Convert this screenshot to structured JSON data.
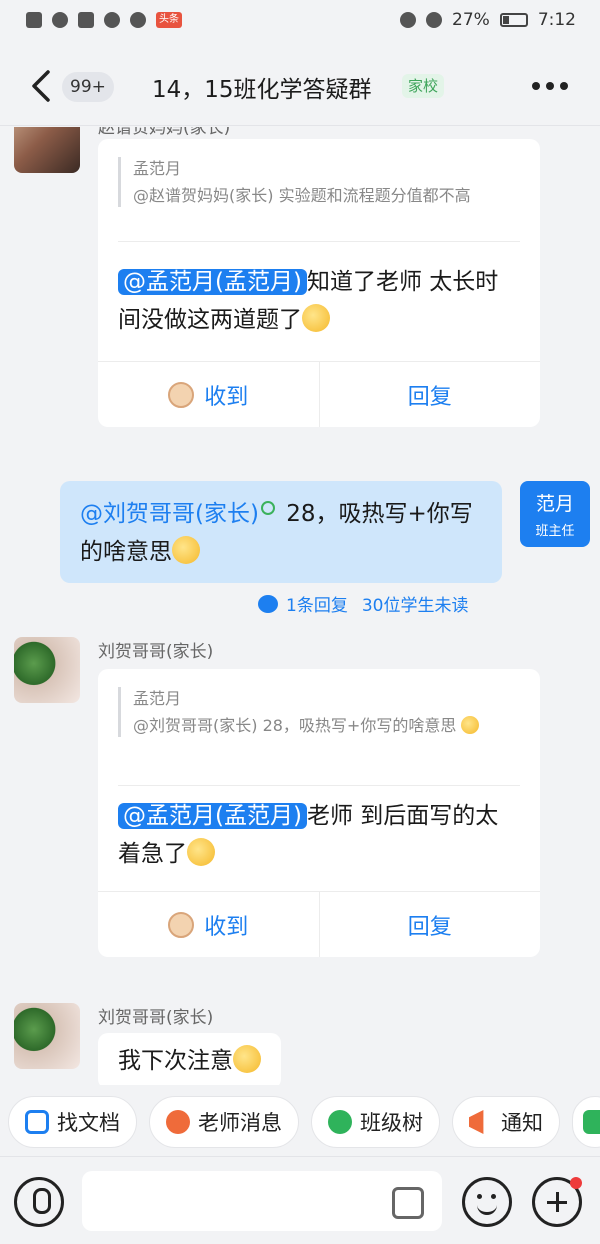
{
  "status_bar": {
    "battery": "27%",
    "time": "7:12",
    "news_badge": "头条"
  },
  "header": {
    "unread_count": "99+",
    "title": "14，15班化学答疑群",
    "tag": "家校"
  },
  "messages": [
    {
      "sender": "赵谱贺妈妈(家长)",
      "quote_name": "孟范月",
      "quote_text": "@赵谱贺妈妈(家长) 实验题和流程题分值都不高",
      "mention": "@孟范月(孟范月)",
      "text": "知道了老师 太长时间没做这两道题了",
      "ack_label": "收到",
      "reply_label": "回复"
    },
    {
      "mention": "@刘贺哥哥(家长)",
      "text": " 28，吸热写+你写的啥意思",
      "avatar_name": "范月",
      "avatar_role": "班主任",
      "replies": "1条回复",
      "unread": "30位学生未读"
    },
    {
      "sender": "刘贺哥哥(家长)",
      "quote_name": "孟范月",
      "quote_text": "@刘贺哥哥(家长) 28，吸热写+你写的啥意思",
      "mention": "@孟范月(孟范月)",
      "text": "老师 到后面写的太着急了",
      "ack_label": "收到",
      "reply_label": "回复"
    },
    {
      "sender": "刘贺哥哥(家长)",
      "text": "我下次注意"
    }
  ],
  "shortcuts": [
    "找文档",
    "老师消息",
    "班级树",
    "通知"
  ],
  "icons": {
    "doc": "find-doc-icon",
    "teacher": "teacher-msg-icon",
    "tree": "class-tree-icon",
    "notice": "notice-icon",
    "mic": "mic-icon",
    "thumb": "thumbs-up-icon",
    "emoji": "emoji-icon",
    "plus": "plus-icon"
  },
  "colors": {
    "accent": "#1d7ff0",
    "my_bubble": "#cfe6fb",
    "tag": "#3fa55b"
  }
}
